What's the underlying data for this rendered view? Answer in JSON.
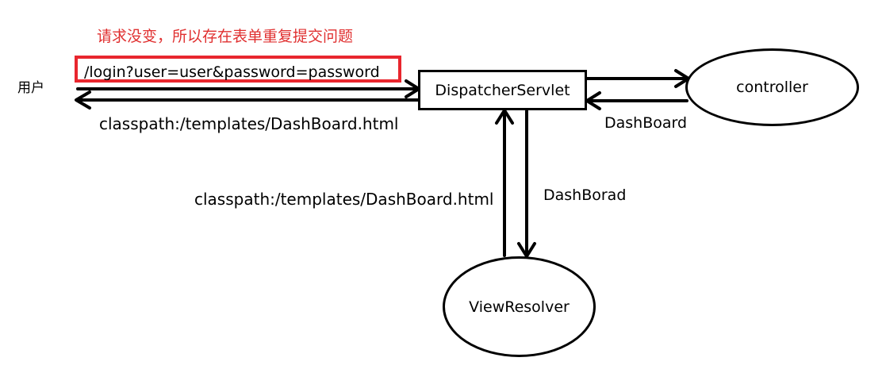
{
  "annotation": {
    "note": "请求没变，所以存在表单重复提交问题"
  },
  "request": {
    "url": "/login?user=user&password=password"
  },
  "actors": {
    "user": "用户"
  },
  "nodes": {
    "dispatcher": "DispatcherServlet",
    "controller": "controller",
    "view_resolver": "ViewResolver"
  },
  "edges": {
    "response_to_user": "classpath:/templates/DashBoard.html",
    "controller_return": "DashBoard",
    "to_view_resolver": "DashBorad",
    "from_view_resolver": "classpath:/templates/DashBoard.html"
  },
  "colors": {
    "annotation": "#e03030",
    "highlight_box": "#e8262e",
    "stroke": "#000000"
  }
}
